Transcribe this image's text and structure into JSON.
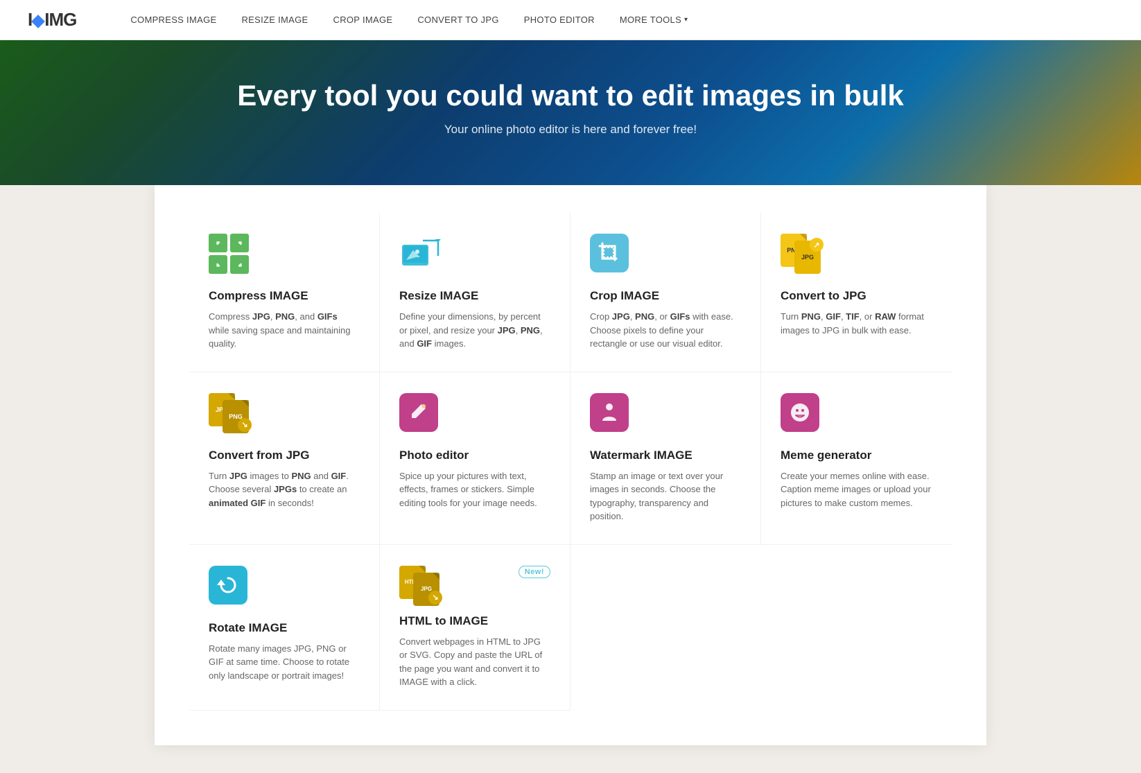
{
  "nav": {
    "logo_heart": "I",
    "logo_name": "IMG",
    "links": [
      {
        "label": "COMPRESS IMAGE",
        "id": "compress"
      },
      {
        "label": "RESIZE IMAGE",
        "id": "resize"
      },
      {
        "label": "CROP IMAGE",
        "id": "crop"
      },
      {
        "label": "CONVERT TO JPG",
        "id": "convert-to-jpg"
      },
      {
        "label": "PHOTO EDITOR",
        "id": "photo-editor"
      },
      {
        "label": "MORE TOOLS",
        "id": "more-tools"
      }
    ]
  },
  "hero": {
    "headline_regular": "Every tool you could want to ",
    "headline_bold": "edit images in bulk",
    "subtext": "Your online photo editor is here and forever free!"
  },
  "tools": [
    {
      "id": "compress",
      "name": "Compress IMAGE",
      "desc": "Compress JPG, PNG, and GIFs while saving space and maintaining quality.",
      "icon_type": "compress"
    },
    {
      "id": "resize",
      "name": "Resize IMAGE",
      "desc": "Define your dimensions, by percent or pixel, and resize your JPG, PNG, and GIF images.",
      "icon_type": "resize"
    },
    {
      "id": "crop",
      "name": "Crop IMAGE",
      "desc": "Crop JPG, PNG, or GIFs with ease. Choose pixels to define your rectangle or use our visual editor.",
      "icon_type": "crop"
    },
    {
      "id": "convert-to-jpg",
      "name": "Convert to JPG",
      "desc": "Turn PNG, GIF, TIF, or RAW format images to JPG in bulk with ease.",
      "icon_type": "convert-to-jpg"
    },
    {
      "id": "convert-from-jpg",
      "name": "Convert from JPG",
      "desc": "Turn JPG images to PNG and GIF. Choose several JPGs to create an animated GIF in seconds!",
      "icon_type": "convert-from-jpg"
    },
    {
      "id": "photo-editor",
      "name": "Photo editor",
      "desc": "Spice up your pictures with text, effects, frames or stickers. Simple editing tools for your image needs.",
      "icon_type": "photo-editor"
    },
    {
      "id": "watermark",
      "name": "Watermark IMAGE",
      "desc": "Stamp an image or text over your images in seconds. Choose the typography, transparency and position.",
      "icon_type": "watermark"
    },
    {
      "id": "meme",
      "name": "Meme generator",
      "desc": "Create your memes online with ease. Caption meme images or upload your pictures to make custom memes.",
      "icon_type": "meme"
    },
    {
      "id": "rotate",
      "name": "Rotate IMAGE",
      "desc": "Rotate many images JPG, PNG or GIF at same time. Choose to rotate only landscape or portrait images!",
      "icon_type": "rotate"
    },
    {
      "id": "html-to-image",
      "name": "HTML to IMAGE",
      "desc": "Convert webpages in HTML to JPG or SVG. Copy and paste the URL of the page you want and convert it to IMAGE with a click.",
      "icon_type": "html-to-image",
      "badge": "New!"
    }
  ]
}
